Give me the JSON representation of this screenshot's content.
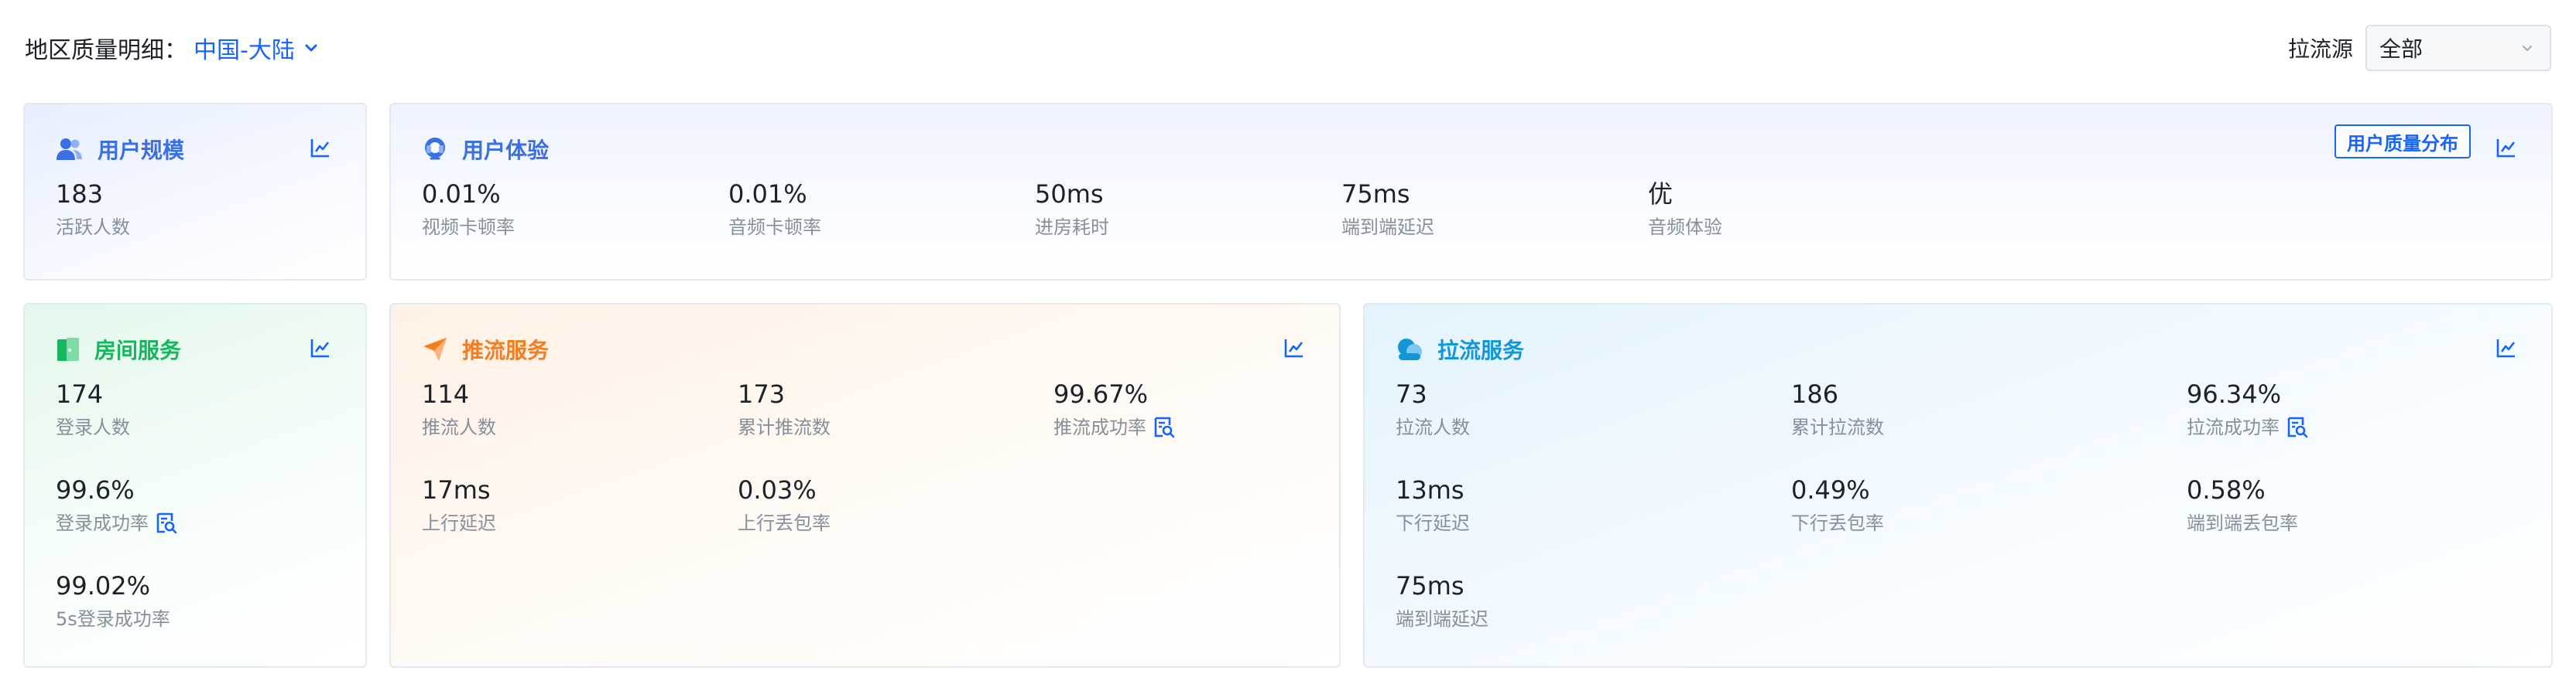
{
  "header": {
    "title": "地区质量明细：",
    "region": "中国-大陆"
  },
  "source_filter": {
    "label": "拉流源",
    "value": "全部"
  },
  "user_scale": {
    "title": "用户规模",
    "metrics": [
      {
        "value": "183",
        "label": "活跃人数"
      }
    ]
  },
  "user_experience": {
    "title": "用户体验",
    "quality_button": "用户质量分布",
    "metrics": [
      {
        "value": "0.01%",
        "label": "视频卡顿率"
      },
      {
        "value": "0.01%",
        "label": "音频卡顿率"
      },
      {
        "value": "50ms",
        "label": "进房耗时"
      },
      {
        "value": "75ms",
        "label": "端到端延迟"
      },
      {
        "value": "优",
        "label": "音频体验"
      }
    ]
  },
  "room_service": {
    "title": "房间服务",
    "metrics": [
      {
        "value": "174",
        "label": "登录人数"
      },
      {
        "value": "99.6%",
        "label": "登录成功率"
      },
      {
        "value": "99.02%",
        "label": "5s登录成功率"
      }
    ]
  },
  "push_service": {
    "title": "推流服务",
    "metrics": [
      {
        "value": "114",
        "label": "推流人数"
      },
      {
        "value": "173",
        "label": "累计推流数"
      },
      {
        "value": "99.67%",
        "label": "推流成功率"
      },
      {
        "value": "17ms",
        "label": "上行延迟"
      },
      {
        "value": "0.03%",
        "label": "上行丢包率"
      }
    ]
  },
  "pull_service": {
    "title": "拉流服务",
    "metrics": [
      {
        "value": "73",
        "label": "拉流人数"
      },
      {
        "value": "186",
        "label": "累计拉流数"
      },
      {
        "value": "96.34%",
        "label": "拉流成功率"
      },
      {
        "value": "13ms",
        "label": "下行延迟"
      },
      {
        "value": "0.49%",
        "label": "下行丢包率"
      },
      {
        "value": "0.58%",
        "label": "端到端丢包率"
      },
      {
        "value": "75ms",
        "label": "端到端延迟"
      }
    ]
  },
  "colors": {
    "primary": "#1664ff",
    "user_scale": "#3b6fe6",
    "room_green": "#14b85c",
    "push_orange": "#f57c1f",
    "pull_blue": "#1296db",
    "label_grey": "#86909c"
  },
  "icons": {
    "region": "chevron-down-icon",
    "select": "chevron-down-icon",
    "trend": "trend-chart-icon",
    "diagnose": "diagnose-search-icon",
    "user_scale": "users-icon",
    "user_experience": "headset-icon",
    "room_service": "door-icon",
    "push_service": "send-plane-icon",
    "pull_service": "cloud-icon"
  }
}
